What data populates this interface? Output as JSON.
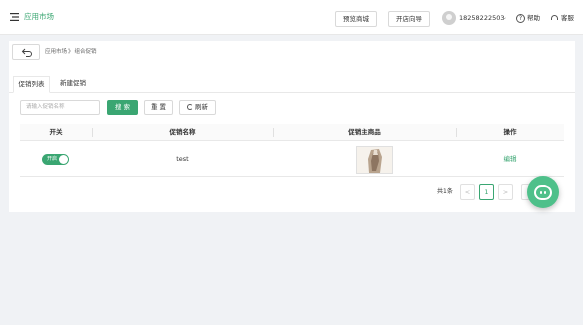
{
  "topbar": {
    "app_title": "应用市场",
    "preview_label": "预览商城",
    "guide_label": "开店向导",
    "phone": "18258222503",
    "help_label": "帮助",
    "service_label": "客服"
  },
  "breadcrumb": {
    "root": "应用市场",
    "separator": "》",
    "current": "组合促销"
  },
  "tabs": [
    {
      "label": "促销列表",
      "active": true
    },
    {
      "label": "新建促销",
      "active": false
    }
  ],
  "search": {
    "placeholder": "请输入促销名称",
    "search_label": "搜 索",
    "reset_label": "重 置",
    "refresh_label": "刷新"
  },
  "table": {
    "columns": [
      "开关",
      "促销名称",
      "促销主商品",
      "操作"
    ],
    "rows": [
      {
        "switch_label": "开启",
        "switch_on": true,
        "name": "test",
        "action": "编辑"
      }
    ]
  },
  "pagination": {
    "total_text": "共1条",
    "prev": "<",
    "current_page": "1",
    "next": ">"
  },
  "colors": {
    "accent": "#3aa672",
    "chat": "#4ec08a"
  },
  "icons": {
    "menu": "menu-icon",
    "back": "back-arrow-icon",
    "help": "help-circle-icon",
    "service": "headset-icon",
    "refresh": "refresh-icon",
    "chat": "chat-robot-icon"
  }
}
